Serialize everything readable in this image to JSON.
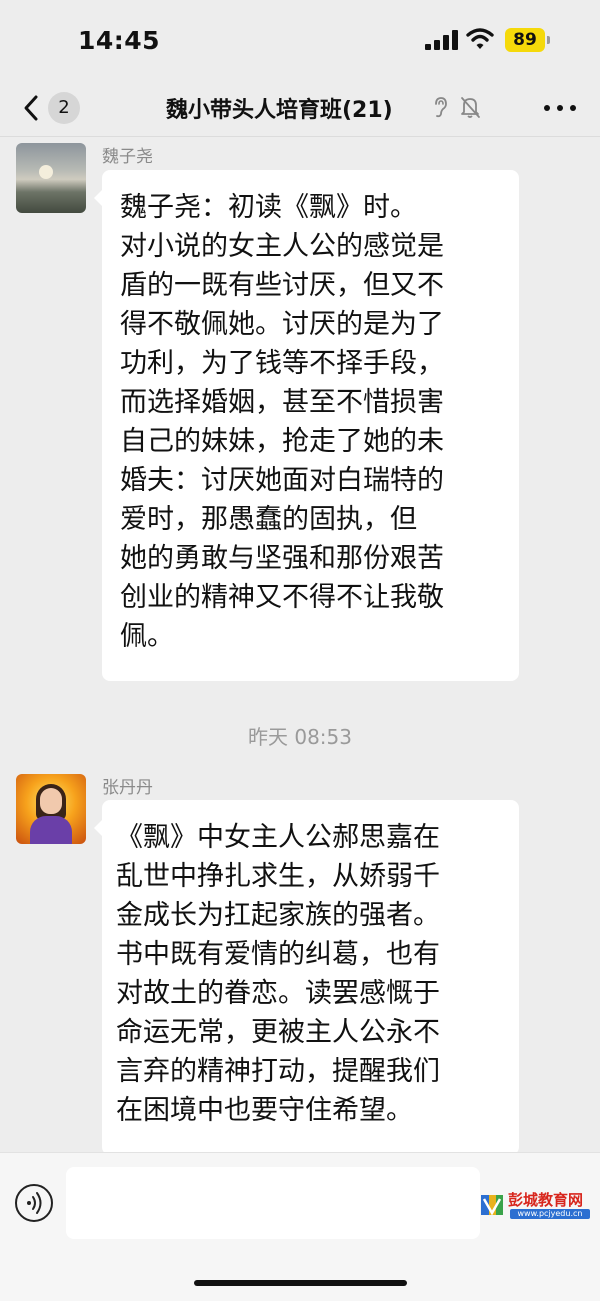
{
  "status_bar": {
    "time": "14:45",
    "battery": "89"
  },
  "nav": {
    "unread_count": "2",
    "title": "魏小带头人培育班(21)"
  },
  "messages": [
    {
      "sender": "魏子尧",
      "lines": [
        " 魏子尧：初读《飘》时。",
        "对小说的女主人公的感觉是",
        "盾的一既有些讨厌，但又不",
        "得不敬佩她。讨厌的是为了",
        "功利，为了钱等不择手段，",
        "而选择婚姻，甚至不惜损害",
        "自己的妹妹，抢走了她的未",
        "婚夫：讨厌她面对白瑞特的",
        "爱时，那愚蠢的固执，但",
        "她的勇敢与坚强和那份艰苦",
        "创业的精神又不得不让我敬",
        "佩。"
      ]
    },
    {
      "sender": "张丹丹",
      "lines": [
        "《飘》中女主人公郝思嘉在",
        "乱世中挣扎求生，从娇弱千",
        "金成长为扛起家族的强者。",
        "书中既有爱情的纠葛，也有",
        "对故土的眷恋。读罢感慨于",
        "命运无常，更被主人公永不",
        "言弃的精神打动，提醒我们",
        "在困境中也要守住希望。"
      ]
    }
  ],
  "timestamp": "昨天 08:53",
  "input": {
    "value": "",
    "placeholder": ""
  },
  "watermark": {
    "title": "彭城教育网",
    "url": "www.pcjyedu.cn"
  },
  "icons": {
    "back": "chevron-left-icon",
    "ear": "ear-icon",
    "mute": "bell-slash-icon",
    "more": "more-dots-icon",
    "voice": "voice-icon"
  },
  "colors": {
    "background": "#ededed",
    "bubble": "#ffffff",
    "battery": "#f5d90a",
    "watermark_red": "#d8261d"
  }
}
